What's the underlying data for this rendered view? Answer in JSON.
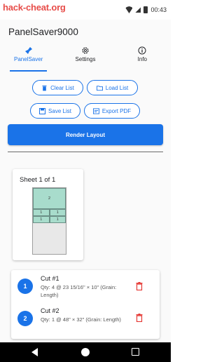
{
  "status_bar": {
    "watermark": "hack-cheat.org",
    "time": "00:43"
  },
  "app": {
    "title": "PanelSaver9000"
  },
  "tabs": [
    {
      "label": "PanelSaver",
      "icon": "broom-icon",
      "active": true
    },
    {
      "label": "Settings",
      "icon": "gear-icon",
      "active": false
    },
    {
      "label": "Info",
      "icon": "info-icon",
      "active": false
    }
  ],
  "actions": {
    "clear_list": "Clear List",
    "load_list": "Load List",
    "save_list": "Save List",
    "export_pdf": "Export PDF",
    "render_layout": "Render Layout"
  },
  "sheet": {
    "title": "Sheet 1 of 1",
    "pieces": [
      "2",
      "1",
      "1",
      "1",
      "1"
    ]
  },
  "cuts": [
    {
      "number": "1",
      "title": "Cut #1",
      "detail": "Qty: 4 @ 23 15/16\" × 10\" (Grain: Length)"
    },
    {
      "number": "2",
      "title": "Cut #2",
      "detail": "Qty: 1 @ 48\" × 32\" (Grain: Length)"
    }
  ],
  "colors": {
    "accent": "#1a73e8",
    "piece_fill": "#a8dccc",
    "delete": "#e53935"
  }
}
